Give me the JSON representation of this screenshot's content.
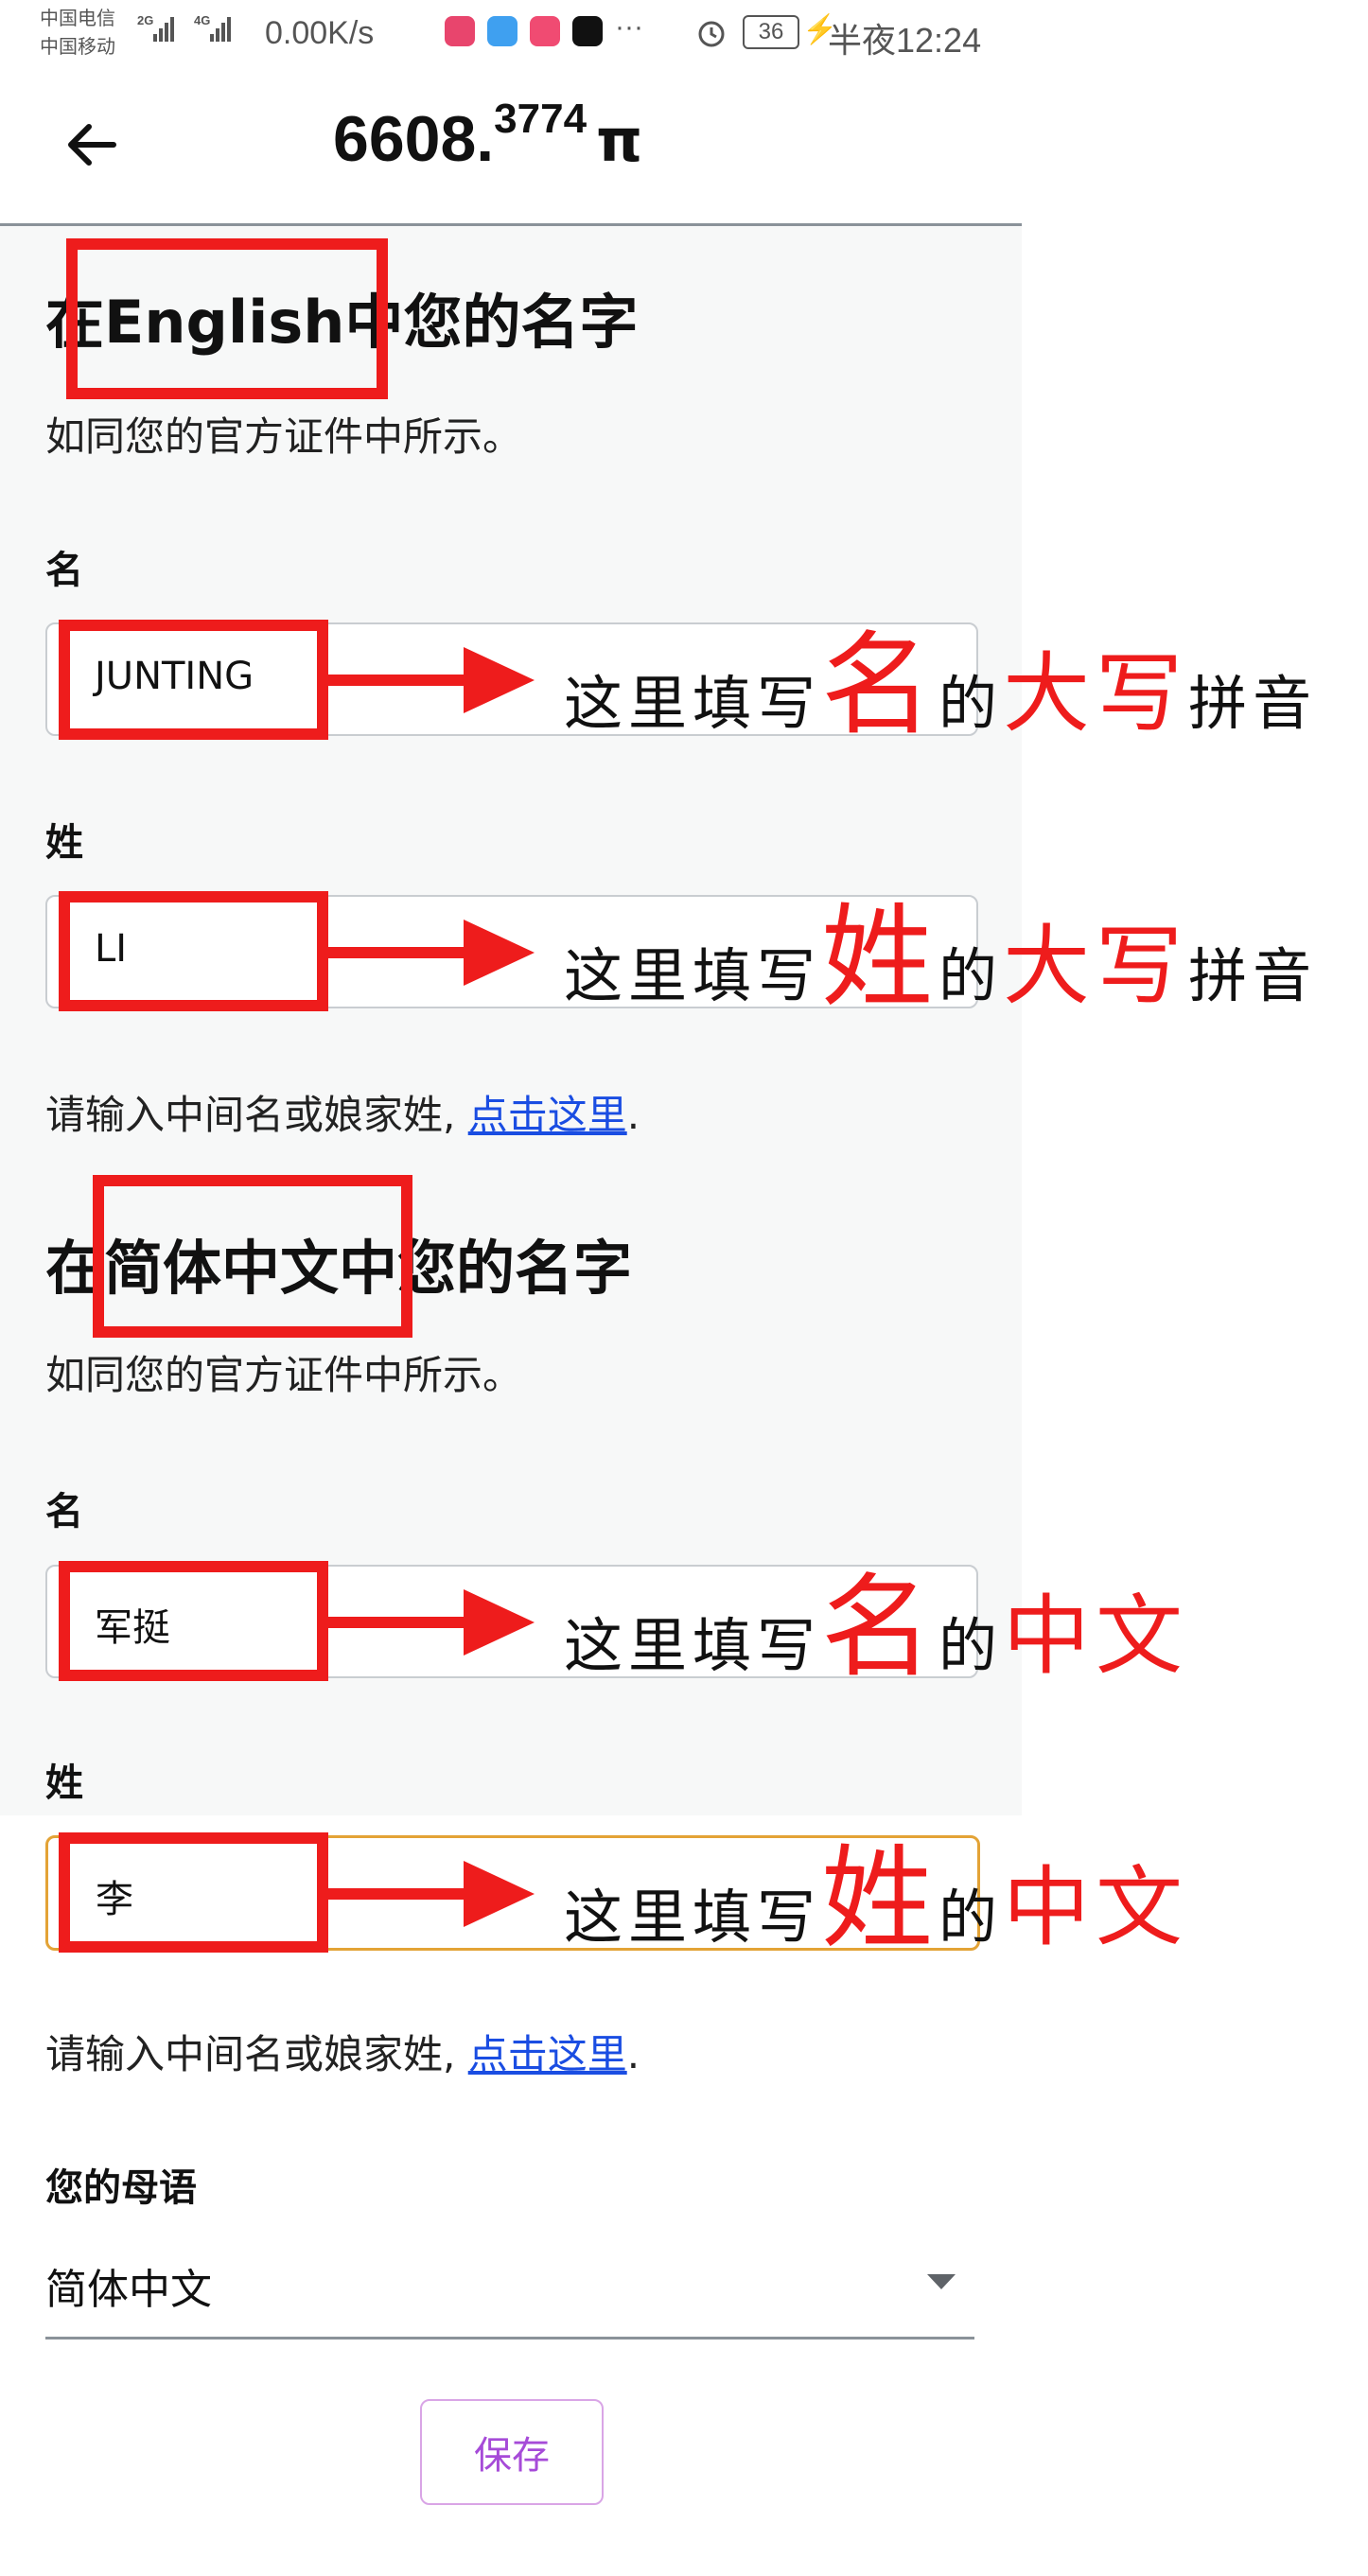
{
  "status_bar": {
    "carrier_1": "中国电信",
    "carrier_2": "中国移动",
    "net_1": "2G",
    "net_2": "4G",
    "speed": "0.00K/s",
    "more": "···",
    "battery": "36",
    "time": "半夜12:24"
  },
  "header": {
    "balance_int": "6608.",
    "balance_frac": "3774",
    "currency": "π"
  },
  "english_section": {
    "title_pre": "在",
    "title_lang": "English",
    "title_post": "中您的名字",
    "subtitle": "如同您的官方证件中所示。",
    "first_label": "名",
    "first_value": "JUNTING",
    "last_label": "姓",
    "last_value": "LI",
    "hint_text": "请输入中间名或娘家姓, ",
    "hint_link": "点击这里",
    "hint_end": "."
  },
  "chinese_section": {
    "title_pre": "在",
    "title_lang": "简体中文",
    "title_post": "中您的名字",
    "subtitle": "如同您的官方证件中所示。",
    "first_label": "名",
    "first_value": "军挺",
    "last_label": "姓",
    "last_value": "李",
    "hint_text": "请输入中间名或娘家姓, ",
    "hint_link": "点击这里",
    "hint_end": "."
  },
  "native_language": {
    "label": "您的母语",
    "value": "简体中文"
  },
  "save_label": "保存",
  "annotations": {
    "prefix": "这里填写",
    "ming": "名",
    "xing": "姓",
    "de": "的",
    "daxie": "大写",
    "pinyin": "拼音",
    "zhongwen": "中文"
  },
  "colors": {
    "annotation_red": "#ee1c1c",
    "link_blue": "#1a4de2",
    "focus_orange": "#e3a336",
    "save_purple": "#a64bd8"
  }
}
